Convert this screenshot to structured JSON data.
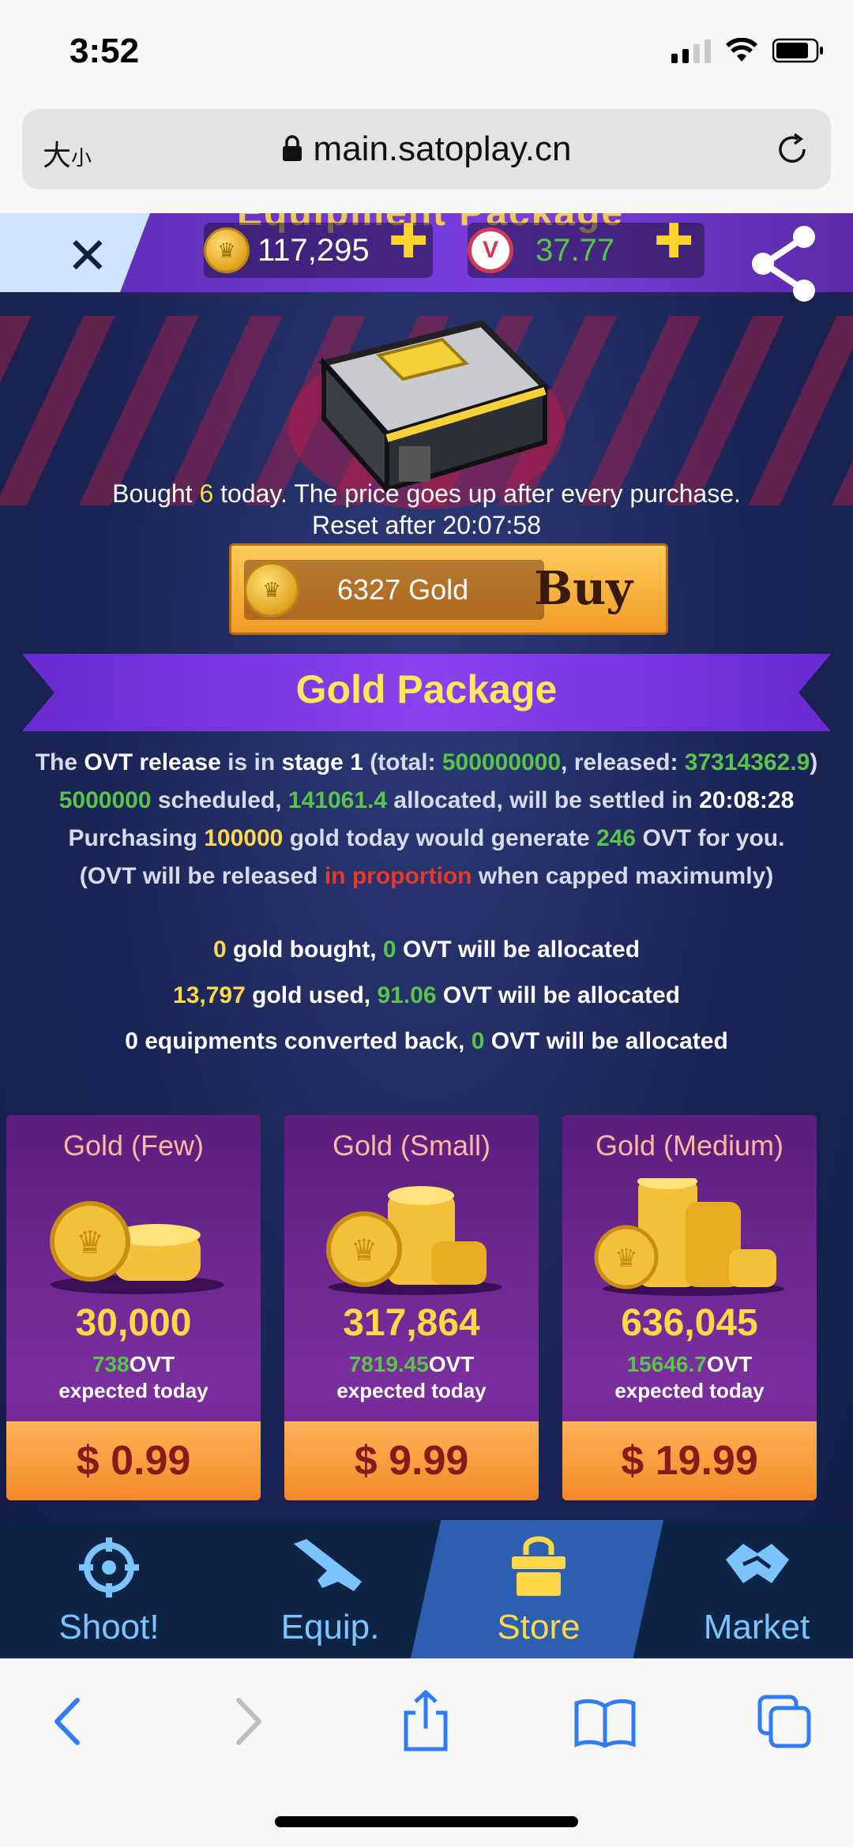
{
  "status": {
    "time": "3:52"
  },
  "browser": {
    "text_size_label": "大",
    "text_size_small": "小",
    "url": "main.satoplay.cn"
  },
  "topbar": {
    "section_title": "Equipment Package",
    "gold_balance": "117,295",
    "ovt_balance": "37.77",
    "ovt_coin_letter": "V"
  },
  "equipment": {
    "bought_prefix": "Bought ",
    "bought_count": "6",
    "bought_suffix": " today. The price goes up after every purchase.",
    "reset_text": "Reset after 20:07:58",
    "price": "6327 Gold",
    "buy_label": "Buy"
  },
  "gold_package": {
    "title": "Gold Package",
    "release": {
      "t1": "The ",
      "ovt_release": "OVT release",
      "t2": " is in ",
      "stage": "stage 1",
      "t3": " (total: ",
      "total": "500000000",
      "t4": ", released: ",
      "released": "37314362.9",
      "t5": ")",
      "scheduled": "5000000",
      "t6": " scheduled, ",
      "allocated": "141061.4",
      "t7": " allocated, will be settled in ",
      "settle_time": "20:08:28",
      "t8": "Purchasing ",
      "purchase_gold": "100000",
      "t9": " gold today would generate ",
      "generate_ovt": "246",
      "t10": " OVT for you.",
      "t11": "(OVT will be released ",
      "proportion": "in proportion",
      "t12": " when capped maximumly)"
    },
    "stats": {
      "bought_gold": "0",
      "bought_text": " gold bought, ",
      "bought_ovt": "0",
      "bought_ovt_text": " OVT will be allocated",
      "used_gold": "13,797",
      "used_text": " gold used, ",
      "used_ovt": "91.06",
      "used_ovt_text": " OVT will be allocated",
      "converted_text": "0 equipments converted back, ",
      "converted_ovt": "0",
      "converted_ovt_text": " OVT will be allocated"
    },
    "packs": [
      {
        "name": "Gold (Few)",
        "amount": "30,000",
        "ovt": "738",
        "ovt_unit": "OVT",
        "expected": "expected today",
        "price": "$ 0.99"
      },
      {
        "name": "Gold (Small)",
        "amount": "317,864",
        "ovt": "7819.45",
        "ovt_unit": "OVT",
        "expected": "expected today",
        "price": "$ 9.99"
      },
      {
        "name": "Gold (Medium)",
        "amount": "636,045",
        "ovt": "15646.7",
        "ovt_unit": "OVT",
        "expected": "expected today",
        "price": "$ 19.99"
      }
    ]
  },
  "gamenav": {
    "shoot": "Shoot!",
    "equip": "Equip.",
    "store": "Store",
    "market": "Market"
  },
  "colors": {
    "accent_gold": "#ffd84a",
    "ovt_green": "#58c548",
    "nav_blue": "#7cc4ff",
    "alert_red": "#e53a2a"
  }
}
